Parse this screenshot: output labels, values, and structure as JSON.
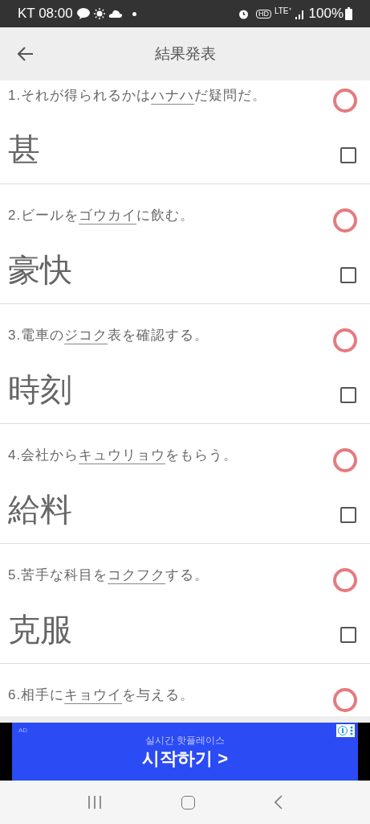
{
  "status_bar": {
    "carrier_time": "KT 08:00",
    "hd": "HD",
    "network": "LTE⁺",
    "battery": "100%"
  },
  "header": {
    "title": "結果発表"
  },
  "questions": [
    {
      "before": "1.それが得られるかは",
      "underlined": "ハナハ",
      "after": "だ疑問だ。",
      "answer": "甚",
      "correct": true,
      "checked": false
    },
    {
      "before": "2.ビールを",
      "underlined": "ゴウカイ",
      "after": "に飲む。",
      "answer": "豪快",
      "correct": true,
      "checked": false
    },
    {
      "before": "3.電車の",
      "underlined": "ジコク",
      "after": "表を確認する。",
      "answer": "時刻",
      "correct": true,
      "checked": false
    },
    {
      "before": "4.会社から",
      "underlined": "キュウリョウ",
      "after": "をもらう。",
      "answer": "給料",
      "correct": true,
      "checked": false
    },
    {
      "before": "5.苦手な科目を",
      "underlined": "コクフク",
      "after": "する。",
      "answer": "克服",
      "correct": true,
      "checked": false
    },
    {
      "before": "6.相手に",
      "underlined": "キョウイ",
      "after": "を与える。",
      "correct": true
    }
  ],
  "ad": {
    "tag": "AD",
    "subtitle": "실시간 핫플레이스",
    "cta": "시작하기 >"
  }
}
